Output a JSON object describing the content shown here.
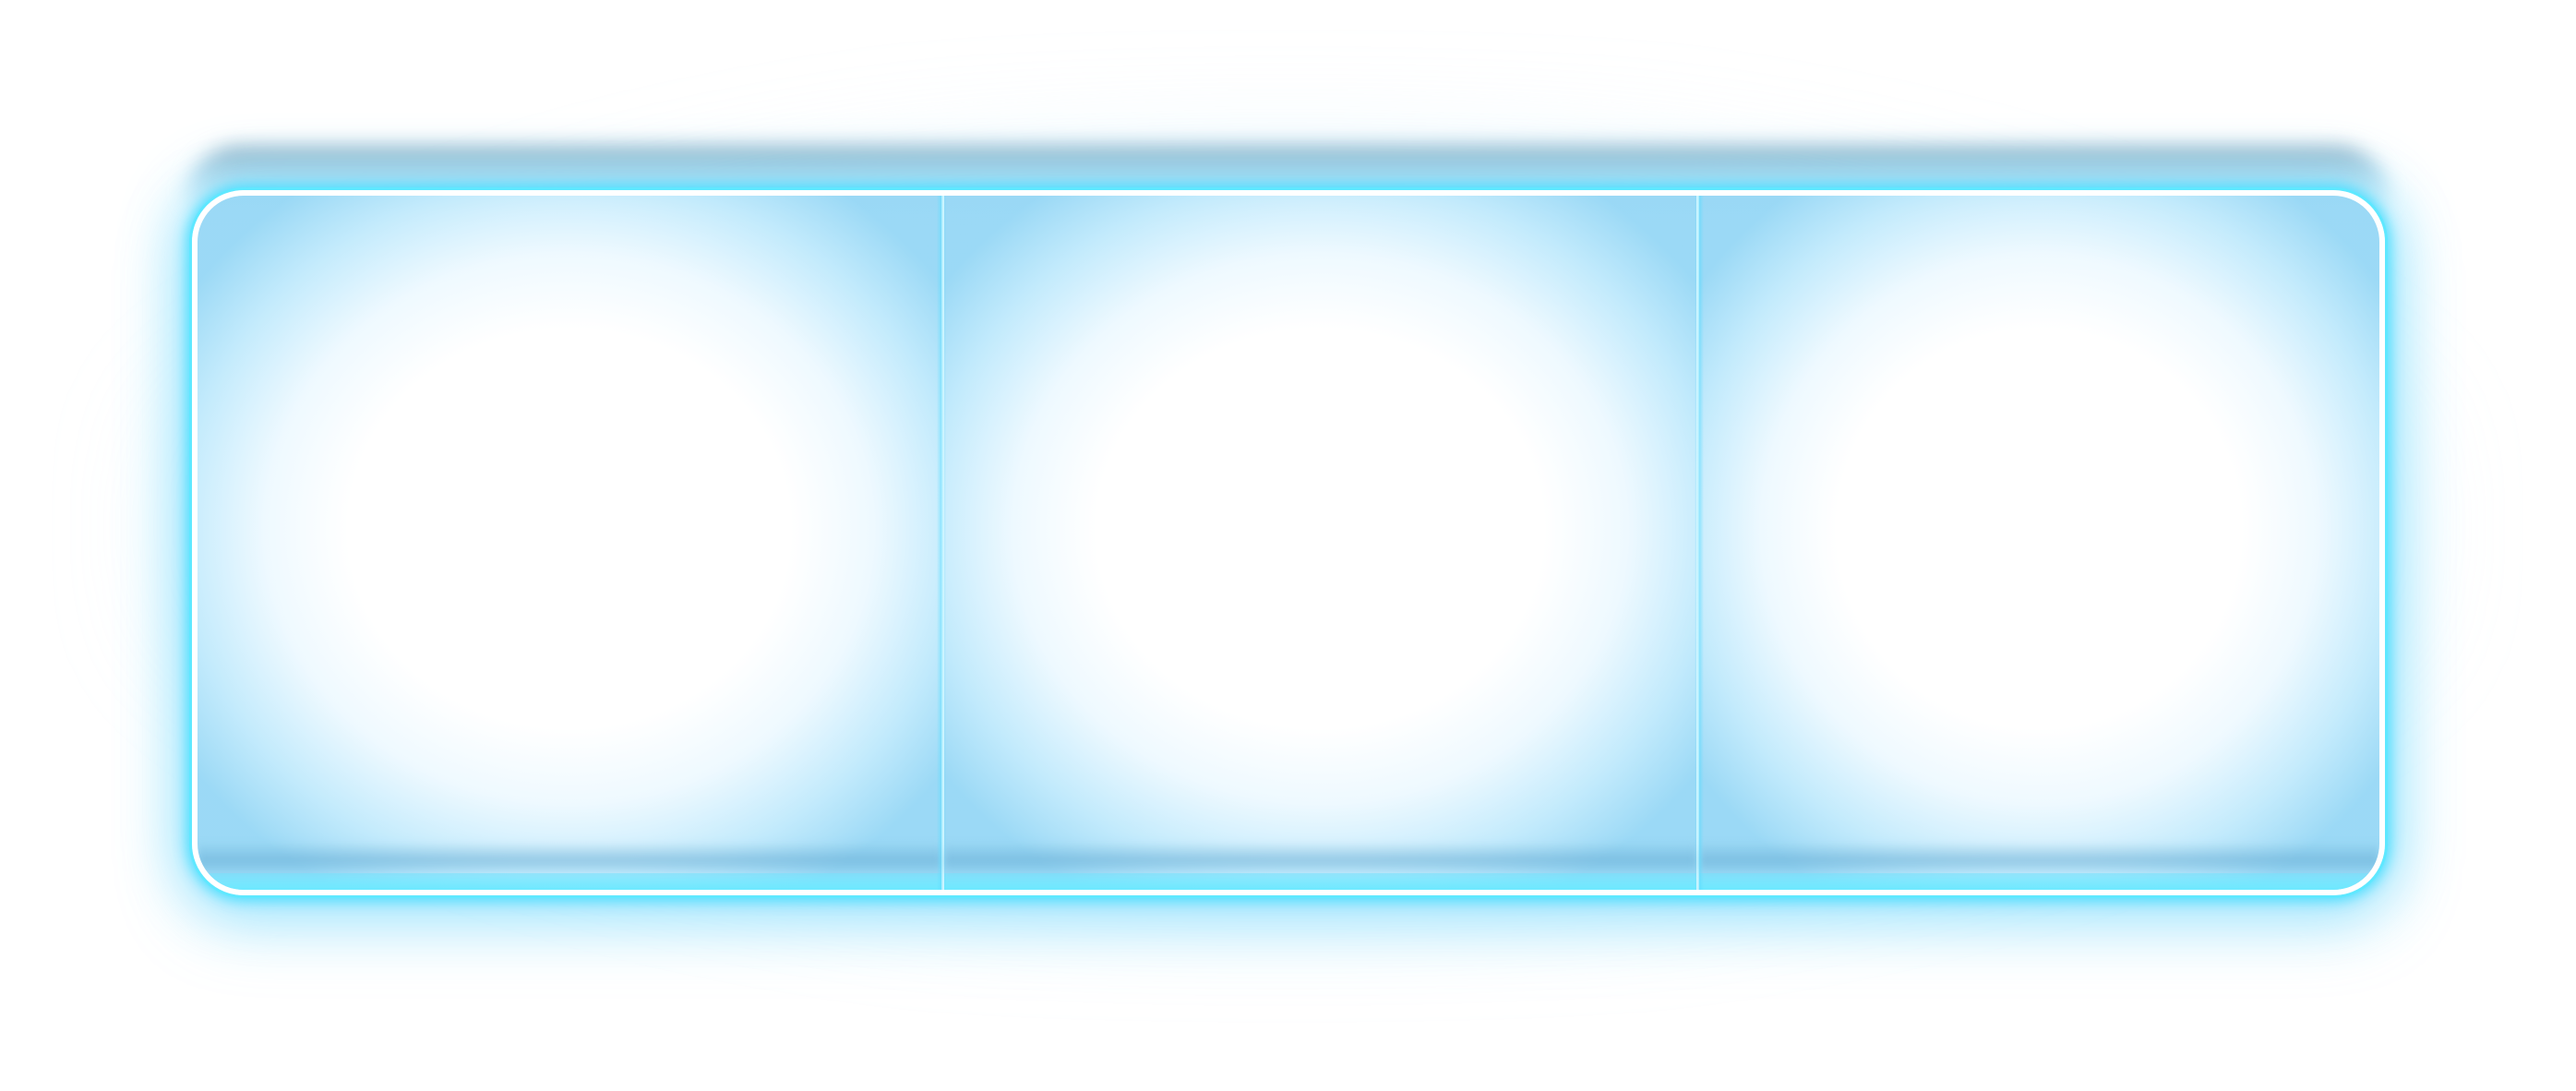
{
  "segmented_control": {
    "segments": [
      {
        "label": ""
      },
      {
        "label": ""
      },
      {
        "label": ""
      }
    ]
  },
  "colors": {
    "glow": "#5fe8ff",
    "border": "#ffffff",
    "fill_center": "#ffffff",
    "fill_edge": "#96d7f5"
  }
}
